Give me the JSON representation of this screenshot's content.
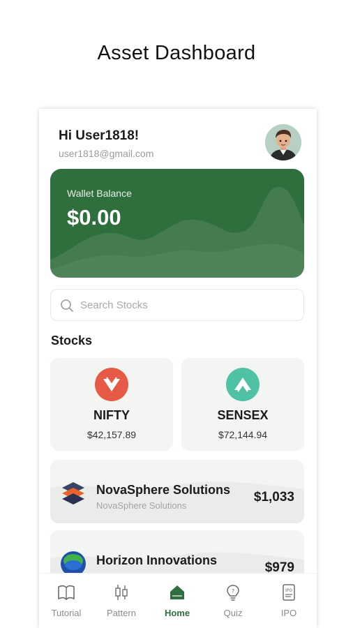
{
  "page": {
    "heading": "Asset Dashboard"
  },
  "user": {
    "greeting": "Hi User1818!",
    "email": "user1818@gmail.com"
  },
  "wallet": {
    "label": "Wallet Balance",
    "amount": "$0.00"
  },
  "search": {
    "placeholder": "Search Stocks",
    "value": ""
  },
  "stocks_section": {
    "title": "Stocks"
  },
  "indices": [
    {
      "name": "NIFTY",
      "price": "$42,157.89",
      "trend": "down",
      "color": "#e65a46",
      "icon": "chevron-down-icon"
    },
    {
      "name": "SENSEX",
      "price": "$72,144.94",
      "trend": "up",
      "color": "#4fc2a6",
      "icon": "chevron-up-icon"
    }
  ],
  "stock_list": [
    {
      "name": "NovaSphere Solutions",
      "subtitle": "NovaSphere Solutions",
      "price": "$1,033",
      "icon": "layers-logo-icon"
    },
    {
      "name": "Horizon Innovations",
      "subtitle": "",
      "price": "$979",
      "icon": "globe-logo-icon"
    }
  ],
  "nav": {
    "items": [
      {
        "label": "Tutorial",
        "icon": "book-icon",
        "active": false
      },
      {
        "label": "Pattern",
        "icon": "candlestick-icon",
        "active": false
      },
      {
        "label": "Home",
        "icon": "home-icon",
        "active": true
      },
      {
        "label": "Quiz",
        "icon": "lightbulb-icon",
        "active": false
      },
      {
        "label": "IPO",
        "icon": "ipo-document-icon",
        "active": false
      }
    ]
  },
  "colors": {
    "brand_green": "#2f6e3d",
    "card_bg": "#f3f5f3",
    "down_red": "#e65a46",
    "up_teal": "#4fc2a6"
  }
}
